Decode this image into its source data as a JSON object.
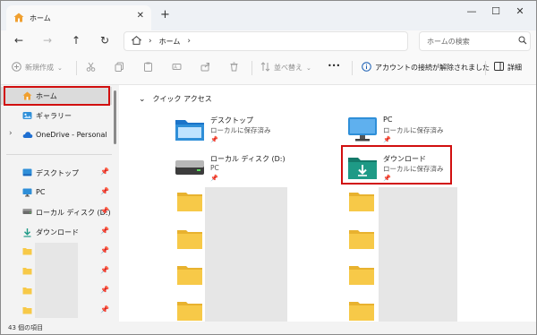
{
  "window": {
    "tab_title": "ホーム",
    "new_tab_symbol": "+",
    "close_tab_symbol": "✕"
  },
  "address_bar": {
    "crumb": "ホーム",
    "search_placeholder": "ホームの検索"
  },
  "toolbar": {
    "new_label": "新規作成",
    "sort_label": "並べ替え",
    "more_label": "•••",
    "notice": "アカウントの接続が解除されました",
    "details_label": "詳細"
  },
  "sidebar": {
    "home": "ホーム",
    "gallery": "ギャラリー",
    "onedrive": "OneDrive - Personal",
    "pinned": [
      {
        "label": "デスクトップ"
      },
      {
        "label": "PC"
      },
      {
        "label": "ローカル ディスク (D:)"
      },
      {
        "label": "ダウンロード"
      }
    ]
  },
  "main": {
    "section_title": "クイック アクセス",
    "items": [
      {
        "name": "デスクトップ",
        "sub": "ローカルに保存済み"
      },
      {
        "name": "PC",
        "sub": "ローカルに保存済み"
      },
      {
        "name": "ローカル ディスク (D:)",
        "sub": "PC"
      },
      {
        "name": "ダウンロード",
        "sub": "ローカルに保存済み"
      }
    ]
  },
  "status": {
    "count_text": "43 個の項目"
  },
  "colors": {
    "highlight_box": "#d10f0f",
    "folder_yellow": "#f7c948",
    "folder_blue": "#2f8fd8",
    "folder_teal": "#1e9a86"
  }
}
